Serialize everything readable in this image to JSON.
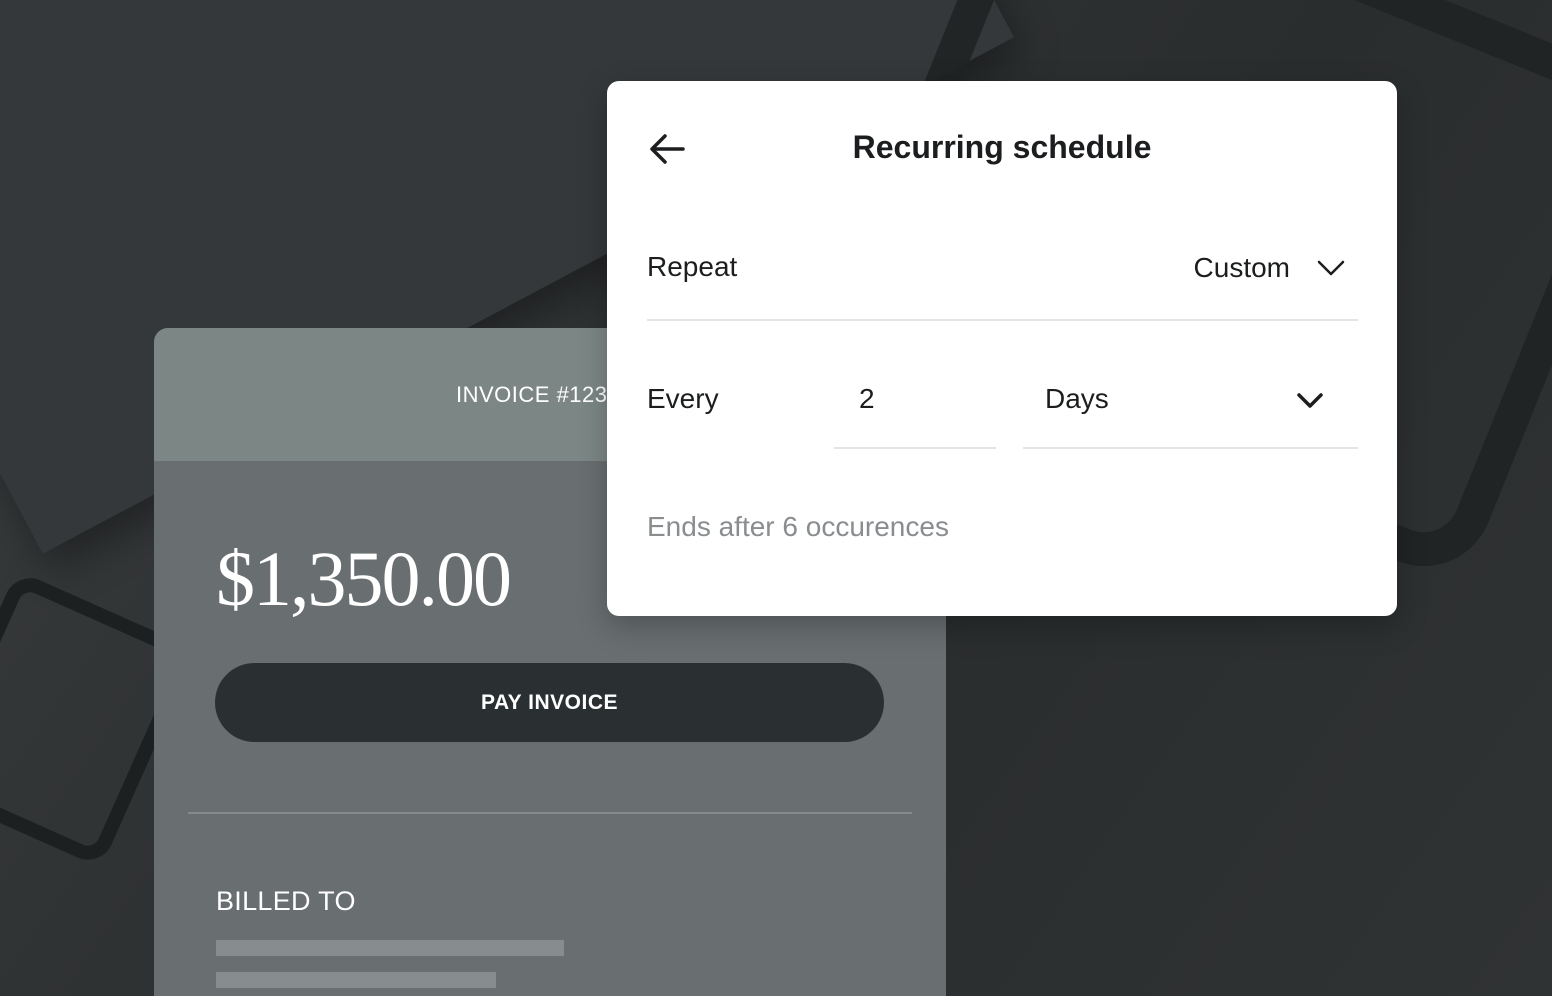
{
  "invoice": {
    "number": "INVOICE #1234",
    "amount": "$1,350.00",
    "pay_button_label": "PAY INVOICE",
    "billed_to_label": "BILLED TO"
  },
  "modal": {
    "title": "Recurring schedule",
    "back_icon": "arrow-left-icon",
    "repeat": {
      "label": "Repeat",
      "value": "Custom",
      "icon": "chevron-down-icon"
    },
    "every": {
      "label": "Every",
      "count": "2",
      "unit": "Days",
      "icon": "chevron-down-icon"
    },
    "ends_text": "Ends after 6 occurences"
  },
  "colors": {
    "background": "#2f3233",
    "invoice_header": "#7c8785",
    "invoice_body": "#696e70",
    "pay_button": "#2a3032",
    "modal_bg": "#ffffff",
    "text_primary": "#1b1d1e",
    "text_muted": "#8a8d8f"
  }
}
